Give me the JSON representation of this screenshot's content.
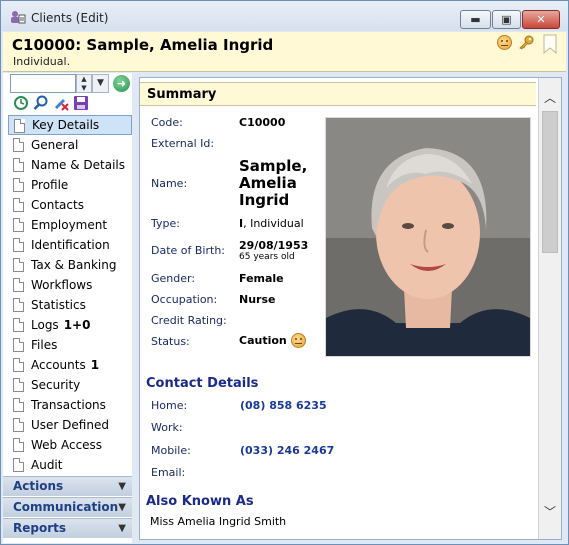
{
  "window": {
    "title": "Clients (Edit)",
    "controls": {
      "minimize": "▬",
      "maximize": "▣",
      "close": "✕"
    }
  },
  "header": {
    "title": "C10000: Sample, Amelia Ingrid",
    "subtitle": "Individual."
  },
  "nav": {
    "items": [
      {
        "label": "Key Details",
        "icon": "key-details-icon",
        "selected": true
      },
      {
        "label": "General",
        "icon": "document-icon"
      },
      {
        "label": "Name & Details",
        "icon": "document-icon"
      },
      {
        "label": "Profile",
        "icon": "document-icon"
      },
      {
        "label": "Contacts",
        "icon": "contacts-icon"
      },
      {
        "label": "Employment",
        "icon": "document-icon"
      },
      {
        "label": "Identification",
        "icon": "document-icon"
      },
      {
        "label": "Tax & Banking",
        "icon": "document-icon"
      },
      {
        "label": "Workflows",
        "icon": "document-icon"
      },
      {
        "label": "Statistics",
        "icon": "document-icon"
      },
      {
        "label": "Logs",
        "icon": "logs-icon",
        "badge": "1+0"
      },
      {
        "label": "Files",
        "icon": "document-icon"
      },
      {
        "label": "Accounts",
        "icon": "document-icon",
        "badge": "1"
      },
      {
        "label": "Security",
        "icon": "document-icon"
      },
      {
        "label": "Transactions",
        "icon": "document-icon"
      },
      {
        "label": "User Defined",
        "icon": "document-icon"
      },
      {
        "label": "Web Access",
        "icon": "web-access-icon"
      },
      {
        "label": "Audit",
        "icon": "audit-icon"
      }
    ],
    "sections": [
      "Actions",
      "Communication",
      "Reports"
    ]
  },
  "summary": {
    "title": "Summary",
    "labels": {
      "code": "Code:",
      "external_id": "External Id:",
      "name": "Name:",
      "type": "Type:",
      "dob": "Date of Birth:",
      "gender": "Gender:",
      "occupation": "Occupation:",
      "credit_rating": "Credit Rating:",
      "status": "Status:"
    },
    "values": {
      "code": "C10000",
      "name": "Sample, Amelia Ingrid",
      "type_code": "I",
      "type_text": ", Individual",
      "dob": "29/08/1953",
      "age": "65 years old",
      "gender": "Female",
      "occupation": "Nurse",
      "status": "Caution"
    }
  },
  "contact": {
    "title": "Contact Details",
    "labels": {
      "home": "Home:",
      "work": "Work:",
      "mobile": "Mobile:",
      "email": "Email:"
    },
    "values": {
      "home": "(08) 858 6235",
      "mobile": "(033) 246 2467"
    }
  },
  "aka": {
    "title": "Also Known As",
    "value": "Miss Amelia Ingrid Smith"
  },
  "colors": {
    "header_bg": "#fff9d6",
    "accent": "#1a2a8a",
    "selected": "#cfe3f8"
  }
}
